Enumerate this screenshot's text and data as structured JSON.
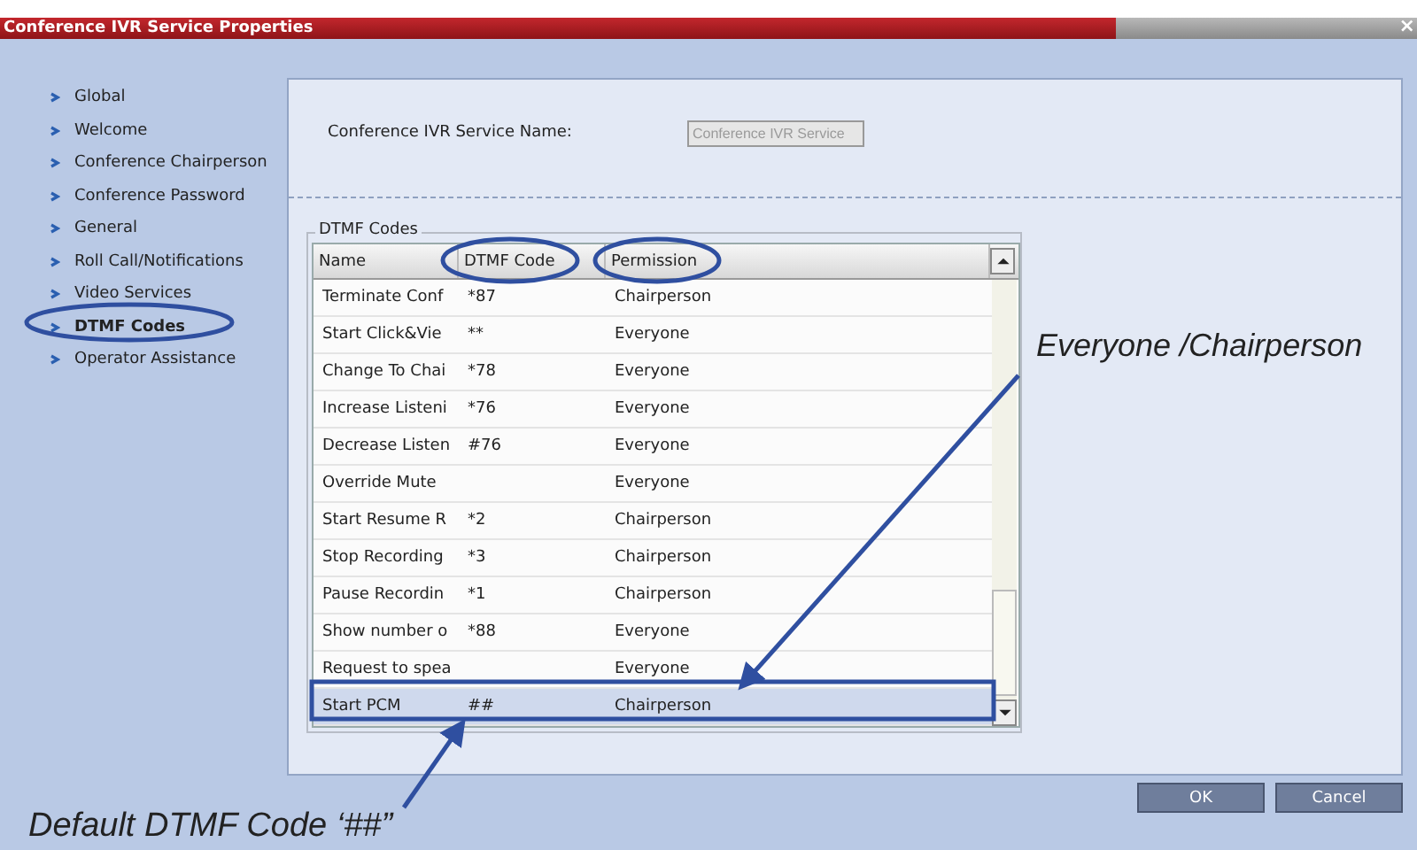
{
  "window": {
    "title": "Conference IVR Service Properties",
    "close": "×"
  },
  "sidebar": {
    "items": [
      {
        "label": "Global",
        "selected": false
      },
      {
        "label": "Welcome",
        "selected": false
      },
      {
        "label": "Conference Chairperson",
        "selected": false
      },
      {
        "label": "Conference Password",
        "selected": false
      },
      {
        "label": "General",
        "selected": false
      },
      {
        "label": "Roll Call/Notifications",
        "selected": false
      },
      {
        "label": "Video Services",
        "selected": false
      },
      {
        "label": "DTMF Codes",
        "selected": true
      },
      {
        "label": "Operator Assistance",
        "selected": false
      }
    ]
  },
  "service_name": {
    "label": "Conference IVR Service Name:",
    "value": "Conference IVR Service",
    "disabled": true
  },
  "dtmf_codes": {
    "legend": "DTMF Codes",
    "columns": [
      "Name",
      "DTMF Code",
      "Permission"
    ],
    "rows": [
      {
        "name": "Terminate Conf",
        "code": "*87",
        "permission": "Chairperson",
        "selected": false
      },
      {
        "name": "Start Click&Vie",
        "code": "**",
        "permission": "Everyone",
        "selected": false
      },
      {
        "name": "Change To Chai",
        "code": "*78",
        "permission": "Everyone",
        "selected": false
      },
      {
        "name": "Increase Listeni",
        "code": "*76",
        "permission": "Everyone",
        "selected": false
      },
      {
        "name": "Decrease Listen",
        "code": "#76",
        "permission": "Everyone",
        "selected": false
      },
      {
        "name": "Override Mute",
        "code": "",
        "permission": "Everyone",
        "selected": false
      },
      {
        "name": "Start Resume R",
        "code": "*2",
        "permission": "Chairperson",
        "selected": false
      },
      {
        "name": "Stop Recording",
        "code": "*3",
        "permission": "Chairperson",
        "selected": false
      },
      {
        "name": "Pause Recordin",
        "code": "*1",
        "permission": "Chairperson",
        "selected": false
      },
      {
        "name": "Show number o",
        "code": "*88",
        "permission": "Everyone",
        "selected": false
      },
      {
        "name": "Request to spea",
        "code": "",
        "permission": "Everyone",
        "selected": false
      },
      {
        "name": "Start PCM",
        "code": "##",
        "permission": "Chairperson",
        "selected": true
      }
    ]
  },
  "buttons": [
    "OK",
    "Cancel"
  ],
  "annotations": {
    "permission_callout": "Everyone /Chairperson",
    "code_callout": "Default DTMF Code ‘##”"
  }
}
